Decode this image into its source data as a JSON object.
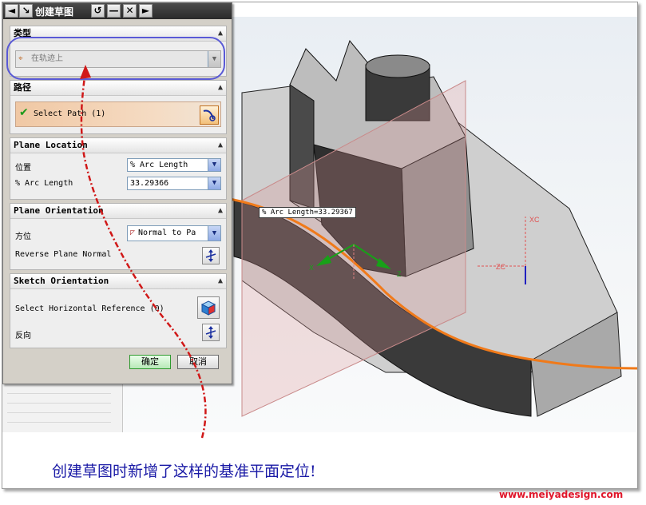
{
  "dialog": {
    "title": "创建草图",
    "titlebar_buttons": [
      "◄",
      "↘",
      "↺",
      "—",
      "✕",
      "►"
    ],
    "type_section": {
      "heading": "类型",
      "type_value": "在轨迹上"
    },
    "path_section": {
      "heading": "路径",
      "select_label": "Select Path (1)"
    },
    "plane_location": {
      "heading": "Plane Location",
      "position_label": "位置",
      "position_value": "% Arc Length",
      "arc_length_label": "% Arc Length",
      "arc_length_value": "33.29366"
    },
    "plane_orientation": {
      "heading": "Plane Orientation",
      "orientation_label": "方位",
      "orientation_value": "Normal to Pa",
      "reverse_label": "Reverse Plane Normal"
    },
    "sketch_orientation": {
      "heading": "Sketch Orientation",
      "horizontal_ref_label": "Select Horizontal Reference (0)",
      "reverse_label": "反向"
    },
    "ok_label": "确定",
    "cancel_label": "取消"
  },
  "viewport": {
    "tooltip": "% Arc Length=33.29367",
    "axis_xc": "XC",
    "axis_zc": "ZC",
    "axis_x": "X",
    "axis_z": "Z"
  },
  "caption": "创建草图时新增了这样的基准平面定位!",
  "watermark": "www.meiyadesign.com",
  "colors": {
    "accent_blue": "#5a5ad6",
    "annotation_red": "#d01818",
    "path_orange": "#f07a1a",
    "caption_blue": "#1a1aa6"
  }
}
